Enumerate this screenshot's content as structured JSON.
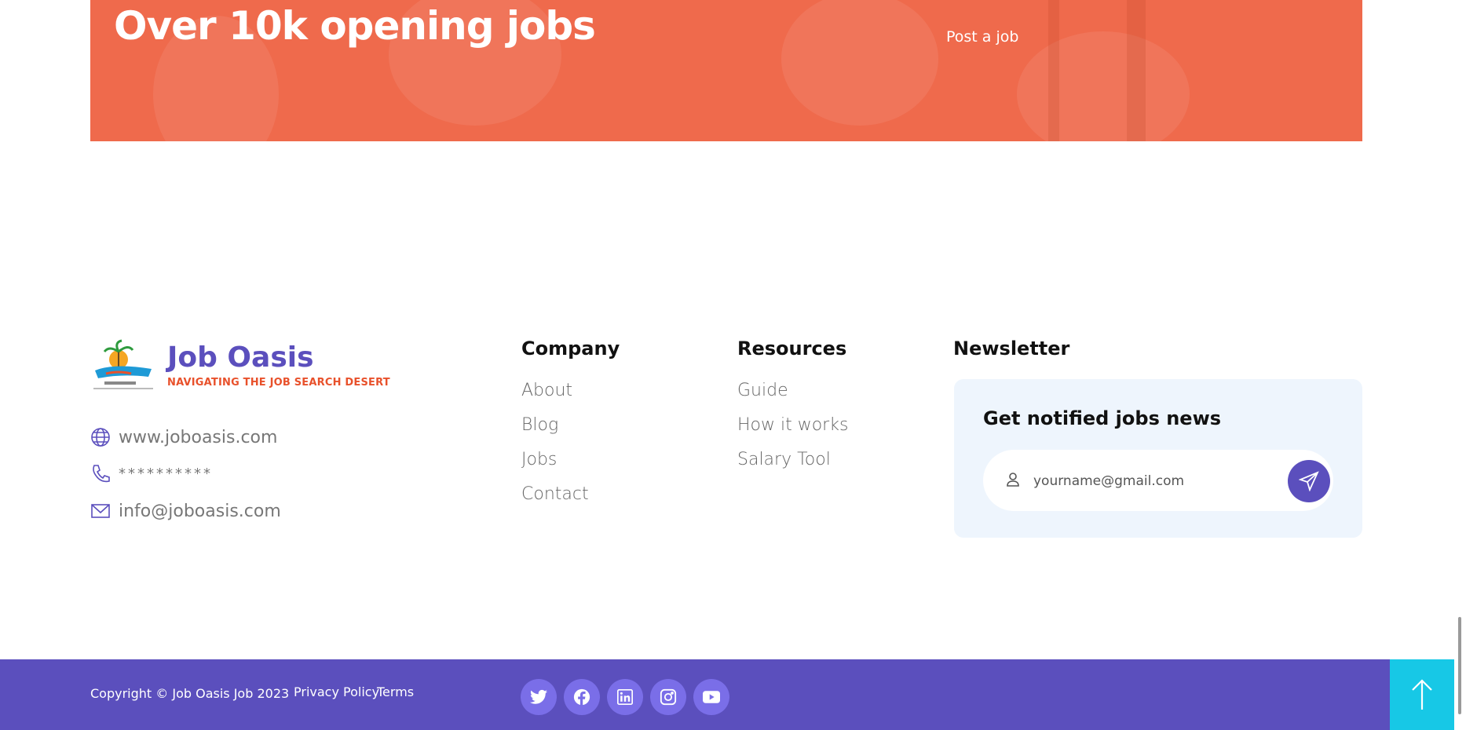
{
  "banner": {
    "title": "Over 10k opening jobs",
    "post_job_label": "Post a job"
  },
  "brand": {
    "name": "Job Oasis",
    "tagline": "NAVIGATING THE JOB SEARCH DESERT"
  },
  "contact": {
    "website": "www.joboasis.com",
    "phone": "**********",
    "email": "info@joboasis.com"
  },
  "company": {
    "title": "Company",
    "links": [
      "About",
      "Blog",
      "Jobs",
      "Contact"
    ]
  },
  "resources": {
    "title": "Resources",
    "links": [
      "Guide",
      "How it works",
      "Salary Tool"
    ]
  },
  "newsletter": {
    "title": "Newsletter",
    "box_title": "Get notified jobs news",
    "placeholder": "yourname@gmail.com"
  },
  "bottom": {
    "copyright": "Copyright © Job Oasis Job 2023",
    "privacy": "Privacy Policy",
    "terms": "Terms",
    "social": [
      "twitter-icon",
      "facebook-icon",
      "linkedin-icon",
      "instagram-icon",
      "youtube-icon"
    ]
  },
  "colors": {
    "banner": "#ef6a4c",
    "brand": "#5b4fbd",
    "accent": "#e8512b",
    "to_top": "#17c8e6"
  }
}
